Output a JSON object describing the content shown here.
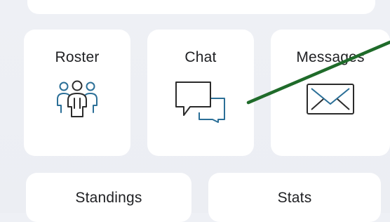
{
  "tiles": {
    "roster": {
      "label": "Roster",
      "icon": "team-icon"
    },
    "chat": {
      "label": "Chat",
      "icon": "chat-bubbles-icon"
    },
    "messages": {
      "label": "Messages",
      "icon": "envelope-icon"
    },
    "standings": {
      "label": "Standings"
    },
    "stats": {
      "label": "Stats"
    }
  },
  "colors": {
    "background": "#eceef3",
    "tile": "#ffffff",
    "icon_dark": "#2b2b2b",
    "icon_accent": "#2b6f97",
    "annotation_arrow": "#1f6b2a"
  }
}
